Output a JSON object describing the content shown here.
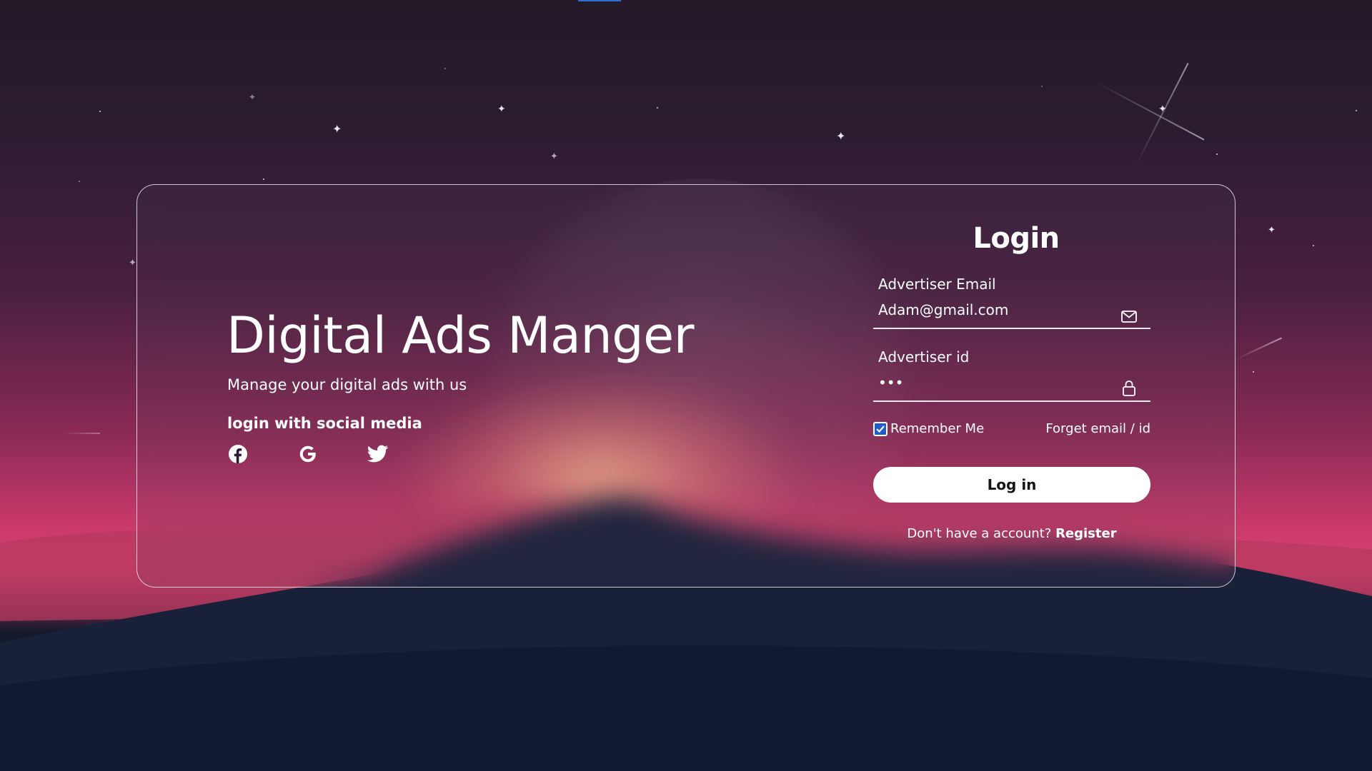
{
  "brand": {
    "title": "Digital Ads Manger",
    "subtitle": "Manage your digital ads with us",
    "social_title": "login with social media",
    "social_icons": [
      "facebook-icon",
      "google-icon",
      "twitter-icon"
    ]
  },
  "login": {
    "title": "Login",
    "email_label": "Advertiser Email",
    "email_value": "Adam@gmail.com",
    "id_label": "Advertiser id",
    "id_value": "•••",
    "remember_label": "Remember Me",
    "remember_checked": true,
    "forgot_label": "Forget email / id",
    "button_label": "Log in",
    "register_prompt": "Don't have a account?",
    "register_link": "Register"
  },
  "colors": {
    "accent": "#1e5cc8",
    "button_bg": "#ffffff",
    "sky_top": "#241a28",
    "horizon": "#db4273",
    "ground": "#141b33"
  }
}
